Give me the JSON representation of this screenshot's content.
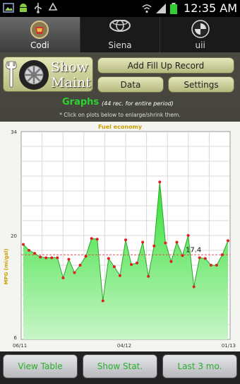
{
  "status_bar": {
    "time": "12:35 AM",
    "icons": [
      "gallery-icon",
      "android-icon",
      "usb-icon",
      "recycle-icon",
      "wifi-icon",
      "signal-icon",
      "battery-icon"
    ]
  },
  "tabs": [
    {
      "label": "Codi",
      "icon": "cadillac-logo-icon",
      "active": true
    },
    {
      "label": "Siena",
      "icon": "toyota-logo-icon",
      "active": false
    },
    {
      "label": "uii",
      "icon": "bmw-logo-icon",
      "active": false
    }
  ],
  "show_maint": {
    "line1": "Show",
    "line2": "Maint"
  },
  "buttons": {
    "add_fill_up": "Add Fill Up Record",
    "data": "Data",
    "settings": "Settings"
  },
  "graphs": {
    "title": "Graphs",
    "subtitle": "(44 rec. for entire period)",
    "hint": "* Click on plots below to enlarge/shrink them."
  },
  "chart_data": {
    "type": "area",
    "title": "Fuel economy",
    "ylabel": "MPG (mi/gal)",
    "xlabel": "",
    "ylim": [
      6,
      34
    ],
    "x_tick_labels": [
      "06/11",
      "04/12",
      "01/13"
    ],
    "y_tick_labels": [
      "34",
      "20",
      "6"
    ],
    "annotation": "17.4",
    "reference_line": 17.4,
    "colors": {
      "fill": "#39e039",
      "line": "#2aa52a",
      "marker": "#e02020",
      "ref_line": "#e05050"
    },
    "values": [
      18.8,
      18.0,
      17.6,
      17.1,
      17.0,
      17.0,
      17.0,
      14.3,
      16.8,
      15.0,
      16.0,
      17.2,
      19.6,
      19.5,
      11.2,
      16.9,
      15.8,
      14.6,
      19.4,
      16.1,
      16.3,
      19.1,
      14.5,
      18.6,
      27.2,
      19.0,
      16.5,
      19.1,
      17.3,
      20.0,
      13.1,
      17.0,
      16.9,
      16.0,
      16.0,
      17.4,
      19.3
    ]
  },
  "bottom_buttons": {
    "view_table": "View Table",
    "show_stat": "Show Stat.",
    "last_3_mo": "Last 3 mo."
  }
}
